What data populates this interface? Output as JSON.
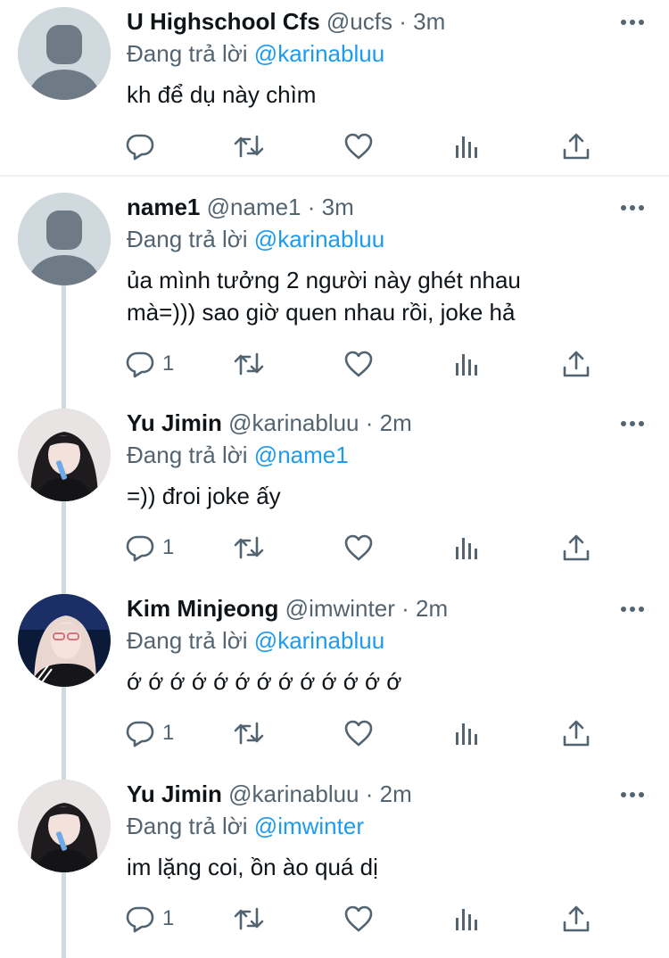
{
  "colors": {
    "accent": "#1d9bf0",
    "secondary_text": "#536471",
    "primary_text": "#0f1419",
    "thread_line": "#cfd9de"
  },
  "icons": {
    "reply": "reply-icon",
    "retweet": "retweet-icon",
    "like": "like-icon",
    "analytics": "analytics-icon",
    "share": "share-icon",
    "more": "more-icon"
  },
  "tweets": [
    {
      "name": "U Highschool Cfs",
      "handle": "@ucfs",
      "separator": "·",
      "time": "3m",
      "replying_prefix": "Đang trả lời",
      "replying_to": "@karinabluu",
      "text": "kh để dụ này chìm",
      "reply_count": "",
      "avatar": "default-avatar"
    },
    {
      "name": "name1",
      "handle": "@name1",
      "separator": "·",
      "time": "3m",
      "replying_prefix": "Đang trả lời",
      "replying_to": "@karinabluu",
      "text": "ủa mình tưởng 2 người này ghét nhau mà=))) sao giờ quen nhau rồi, joke hả",
      "reply_count": "1",
      "avatar": "default-avatar"
    },
    {
      "name": "Yu Jimin",
      "handle": "@karinabluu",
      "separator": "·",
      "time": "2m",
      "replying_prefix": "Đang trả lời",
      "replying_to": "@name1",
      "text": "=)) đroi joke ấy",
      "reply_count": "1",
      "avatar": "photo-avatar"
    },
    {
      "name": "Kim Minjeong",
      "handle": "@imwinter",
      "separator": "·",
      "time": "2m",
      "replying_prefix": "Đang trả lời",
      "replying_to": "@karinabluu",
      "text": "ớ ớ ớ ớ ớ ớ ớ ớ ớ ớ ớ ớ ớ",
      "reply_count": "1",
      "avatar": "photo-avatar"
    },
    {
      "name": "Yu Jimin",
      "handle": "@karinabluu",
      "separator": "·",
      "time": "2m",
      "replying_prefix": "Đang trả lời",
      "replying_to": "@imwinter",
      "text": "im lặng coi, ồn ào quá dị",
      "reply_count": "1",
      "avatar": "photo-avatar"
    }
  ]
}
